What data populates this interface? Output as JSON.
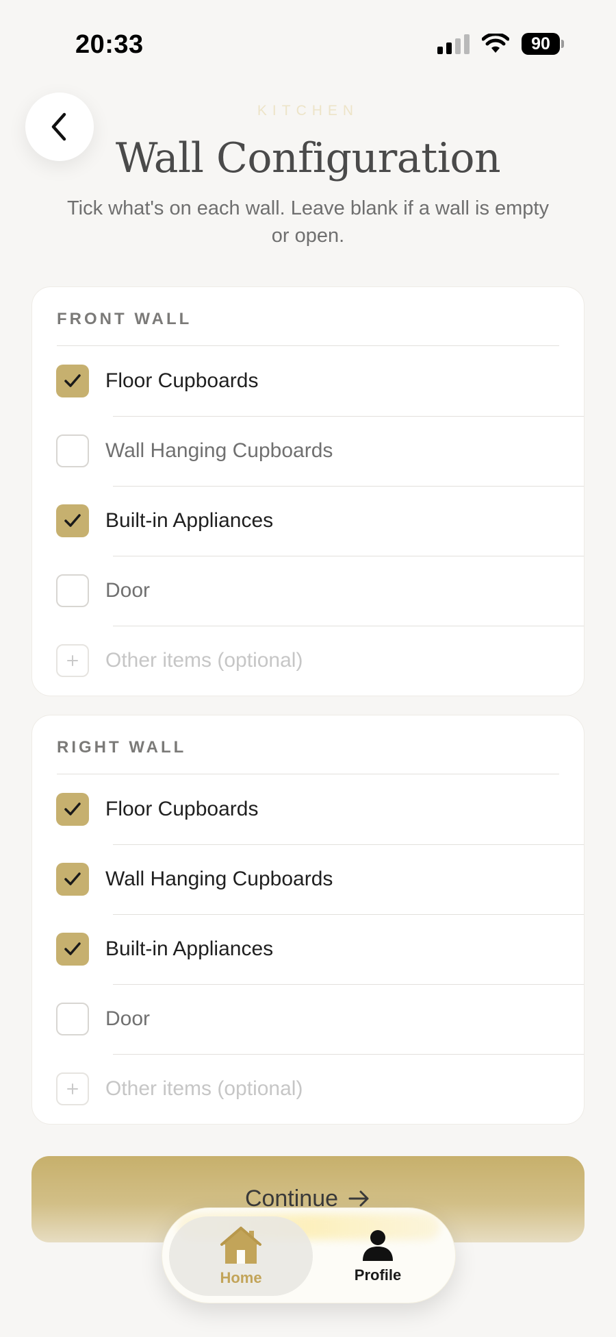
{
  "status_bar": {
    "time": "20:33",
    "battery": "90"
  },
  "header": {
    "eyebrow": "KITCHEN",
    "title": "Wall Configuration",
    "subtitle": "Tick what's on each wall. Leave blank if a wall is empty or open."
  },
  "walls": [
    {
      "title": "FRONT WALL",
      "items": [
        {
          "label": "Floor Cupboards",
          "checked": true
        },
        {
          "label": "Wall Hanging Cupboards",
          "checked": false
        },
        {
          "label": "Built-in Appliances",
          "checked": true
        },
        {
          "label": "Door",
          "checked": false
        }
      ],
      "other_placeholder": "Other items (optional)"
    },
    {
      "title": "RIGHT WALL",
      "items": [
        {
          "label": "Floor Cupboards",
          "checked": true
        },
        {
          "label": "Wall Hanging Cupboards",
          "checked": true
        },
        {
          "label": "Built-in Appliances",
          "checked": true
        },
        {
          "label": "Door",
          "checked": false
        }
      ],
      "other_placeholder": "Other items (optional)"
    }
  ],
  "continue_label": "Continue",
  "tabs": [
    {
      "label": "Home",
      "icon": "home-icon",
      "active": true
    },
    {
      "label": "Profile",
      "icon": "profile-icon",
      "active": false
    }
  ],
  "colors": {
    "accent": "#c6b06f",
    "accent_text": "#c2a459",
    "background": "#f7f6f4"
  }
}
